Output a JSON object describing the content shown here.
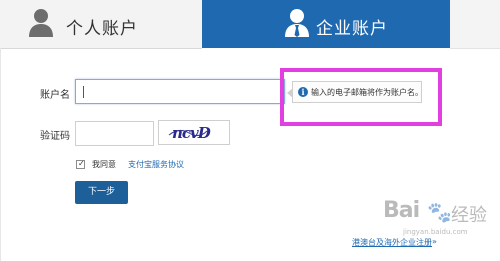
{
  "tabs": {
    "personal_label": "个人账户",
    "enterprise_label": "企业账户"
  },
  "form": {
    "account_label": "账户名",
    "account_value": "",
    "account_tooltip": "输入的电子邮箱将作为账户名。",
    "captcha_label": "验证码",
    "captcha_value": "",
    "captcha_text": "ncvD",
    "agree_text": "我同意",
    "agreement_link": "支付宝服务协议",
    "agreement_checked": true,
    "next_button": "下一步"
  },
  "footer": {
    "region_link": "港澳台及海外企业注册",
    "region_link_arrow": "»"
  },
  "watermark": {
    "main_latin": "Bai",
    "main_paw": "🐾",
    "main_cn": "经验",
    "sub": "jingyan.baidu.com"
  },
  "colors": {
    "brand_blue": "#1f69b1",
    "button_blue": "#1d5f99",
    "highlight_magenta": "#e23fe0"
  }
}
